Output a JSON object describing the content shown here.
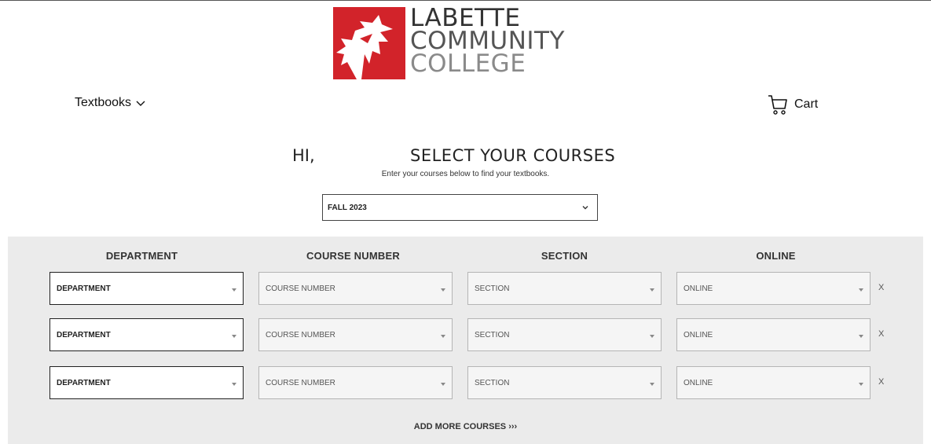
{
  "logo": {
    "line1": "LABETTE",
    "line2": "COMMUNITY",
    "line3": "COLLEGE",
    "brand_red": "#d2232a"
  },
  "nav": {
    "textbooks_label": "Textbooks",
    "cart_label": "Cart"
  },
  "greeting": "HI,",
  "headline": "SELECT YOUR COURSES",
  "subline": "Enter your courses below to find your textbooks.",
  "term_select": {
    "value": "FALL 2023"
  },
  "columns": [
    "DEPARTMENT",
    "COURSE NUMBER",
    "SECTION",
    "ONLINE"
  ],
  "rows": [
    {
      "department": "DEPARTMENT",
      "course_number": "COURSE NUMBER",
      "section": "SECTION",
      "online": "ONLINE",
      "remove": "X"
    },
    {
      "department": "DEPARTMENT",
      "course_number": "COURSE NUMBER",
      "section": "SECTION",
      "online": "ONLINE",
      "remove": "X"
    },
    {
      "department": "DEPARTMENT",
      "course_number": "COURSE NUMBER",
      "section": "SECTION",
      "online": "ONLINE",
      "remove": "X"
    }
  ],
  "add_more_label": "ADD MORE COURSES ›››",
  "icons": {
    "cart": "cart-icon",
    "chevron": "chevron-down-icon",
    "logo": "cardinal-logo-icon"
  }
}
